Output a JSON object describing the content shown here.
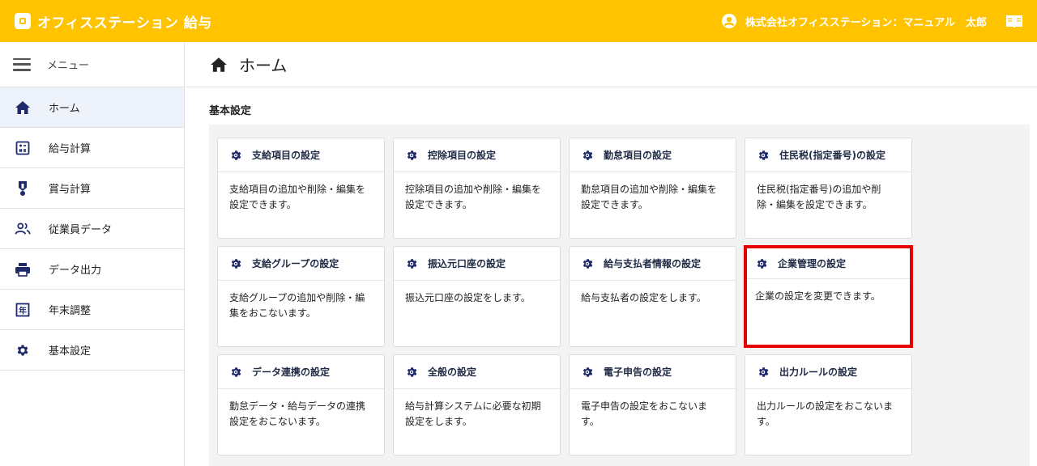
{
  "app": {
    "title": "オフィスステーション 給与",
    "user": "株式会社オフィスステーション：マニュアル　太郎"
  },
  "sidebar": {
    "menu_label": "メニュー",
    "items": [
      {
        "label": "ホーム",
        "icon": "home-icon",
        "active": true
      },
      {
        "label": "給与計算",
        "icon": "calculator-icon"
      },
      {
        "label": "賞与計算",
        "icon": "medal-icon"
      },
      {
        "label": "従業員データ",
        "icon": "people-icon"
      },
      {
        "label": "データ出力",
        "icon": "printer-icon"
      },
      {
        "label": "年末調整",
        "icon": "year-icon"
      },
      {
        "label": "基本設定",
        "icon": "gear-icon"
      }
    ]
  },
  "main": {
    "page_title": "ホーム",
    "section_title": "基本設定",
    "cards": [
      {
        "title": "支給項目の設定",
        "desc": "支給項目の追加や削除・編集を設定できます。"
      },
      {
        "title": "控除項目の設定",
        "desc": "控除項目の追加や削除・編集を設定できます。"
      },
      {
        "title": "勤怠項目の設定",
        "desc": "勤怠項目の追加や削除・編集を設定できます。"
      },
      {
        "title": "住民税(指定番号)の設定",
        "desc": "住民税(指定番号)の追加や削除・編集を設定できます。"
      },
      {
        "title": "支給グループの設定",
        "desc": "支給グループの追加や削除・編集をおこないます。"
      },
      {
        "title": "振込元口座の設定",
        "desc": "振込元口座の設定をします。"
      },
      {
        "title": "給与支払者情報の設定",
        "desc": "給与支払者の設定をします。"
      },
      {
        "title": "企業管理の設定",
        "desc": "企業の設定を変更できます。",
        "highlighted": true
      },
      {
        "title": "データ連携の設定",
        "desc": "勤怠データ・給与データの連携設定をおこないます。"
      },
      {
        "title": "全般の設定",
        "desc": "給与計算システムに必要な初期設定をします。"
      },
      {
        "title": "電子申告の設定",
        "desc": "電子申告の設定をおこないます。"
      },
      {
        "title": "出力ルールの設定",
        "desc": "出力ルールの設定をおこないます。"
      }
    ]
  },
  "colors": {
    "header_bg": "#ffc300",
    "active_nav_bg": "#eef3fb",
    "highlight_border": "#e60000",
    "icon_navy": "#1f2a6b"
  }
}
